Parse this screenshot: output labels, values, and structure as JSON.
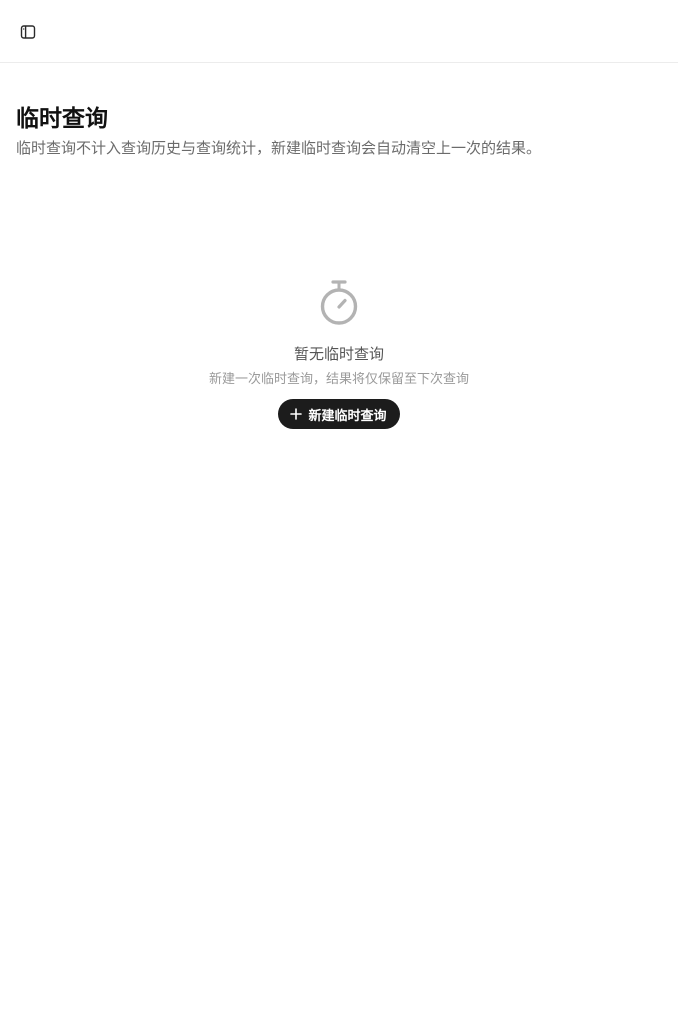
{
  "header": {
    "sidebar_toggle_icon": "sidebar-panel-icon"
  },
  "page": {
    "title": "临时查询",
    "subtitle": "临时查询不计入查询历史与查询统计，新建临时查询会自动清空上一次的结果。"
  },
  "empty_state": {
    "icon": "timer-icon",
    "title": "暂无临时查询",
    "description": "新建一次临时查询，结果将仅保留至下次查询",
    "button_icon": "plus-icon",
    "button_label": "新建临时查询"
  },
  "colors": {
    "button_bg": "#1c1c1c",
    "title": "#111111",
    "subtitle": "#6b6b6b",
    "icon_gray": "#b3b3b3"
  }
}
